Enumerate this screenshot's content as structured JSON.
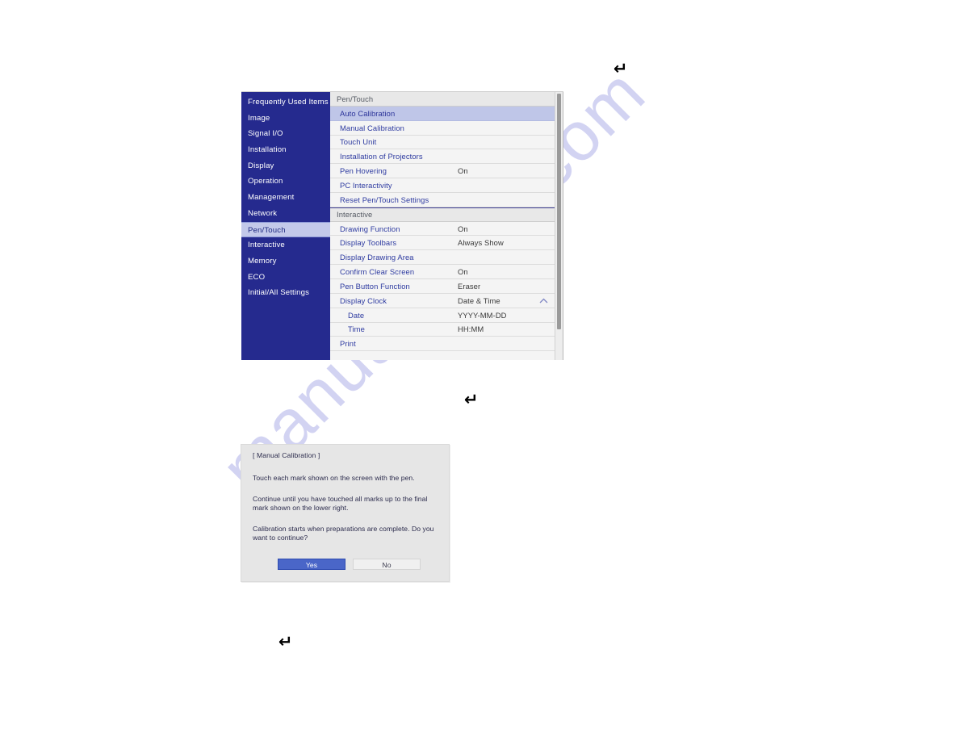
{
  "watermark": {
    "text": "manualshive.com"
  },
  "glyphs": {
    "enter_key": "↵"
  },
  "projector_menu": {
    "sidebar": {
      "items": [
        {
          "label": "Frequently Used Items",
          "selected": false
        },
        {
          "label": "Image",
          "selected": false
        },
        {
          "label": "Signal I/O",
          "selected": false
        },
        {
          "label": "Installation",
          "selected": false
        },
        {
          "label": "Display",
          "selected": false
        },
        {
          "label": "Operation",
          "selected": false
        },
        {
          "label": "Management",
          "selected": false
        },
        {
          "label": "Network",
          "selected": false
        },
        {
          "label": "Pen/Touch",
          "selected": true
        },
        {
          "label": "Interactive",
          "selected": false
        },
        {
          "label": "Memory",
          "selected": false
        },
        {
          "label": "ECO",
          "selected": false
        },
        {
          "label": "Initial/All Settings",
          "selected": false
        }
      ]
    },
    "rows": [
      {
        "label": "Pen/Touch",
        "value": "",
        "type": "section"
      },
      {
        "label": "Auto Calibration",
        "value": "",
        "type": "item",
        "highlight": true
      },
      {
        "label": "Manual Calibration",
        "value": "",
        "type": "item"
      },
      {
        "label": "Touch Unit",
        "value": "",
        "type": "item"
      },
      {
        "label": "Installation of Projectors",
        "value": "",
        "type": "item"
      },
      {
        "label": "Pen Hovering",
        "value": "On",
        "type": "item"
      },
      {
        "label": "PC Interactivity",
        "value": "",
        "type": "item"
      },
      {
        "label": "Reset Pen/Touch Settings",
        "value": "",
        "type": "item"
      },
      {
        "label": "Interactive",
        "value": "",
        "type": "section",
        "divider_top": true
      },
      {
        "label": "Drawing Function",
        "value": "On",
        "type": "item"
      },
      {
        "label": "Display Toolbars",
        "value": "Always Show",
        "type": "item"
      },
      {
        "label": "Display Drawing Area",
        "value": "",
        "type": "item"
      },
      {
        "label": "Confirm Clear Screen",
        "value": "On",
        "type": "item"
      },
      {
        "label": "Pen Button Function",
        "value": "Eraser",
        "type": "item"
      },
      {
        "label": "Display Clock",
        "value": "Date & Time",
        "type": "item",
        "chevron": "chevron-up"
      },
      {
        "label": "Date",
        "value": "YYYY-MM-DD",
        "type": "item",
        "indent": true
      },
      {
        "label": "Time",
        "value": "HH:MM",
        "type": "item",
        "indent": true
      },
      {
        "label": "Print",
        "value": "",
        "type": "item"
      },
      {
        "label": "",
        "value": "",
        "type": "item"
      }
    ]
  },
  "calibration_dialog": {
    "title": "[ Manual Calibration ]",
    "paragraphs": [
      "Touch each mark shown on the screen with the pen.",
      "Continue until you have touched all marks up to the final mark shown on the lower right.",
      "Calibration starts when preparations are complete. Do you want to continue?"
    ],
    "buttons": {
      "yes": "Yes",
      "no": "No"
    }
  }
}
